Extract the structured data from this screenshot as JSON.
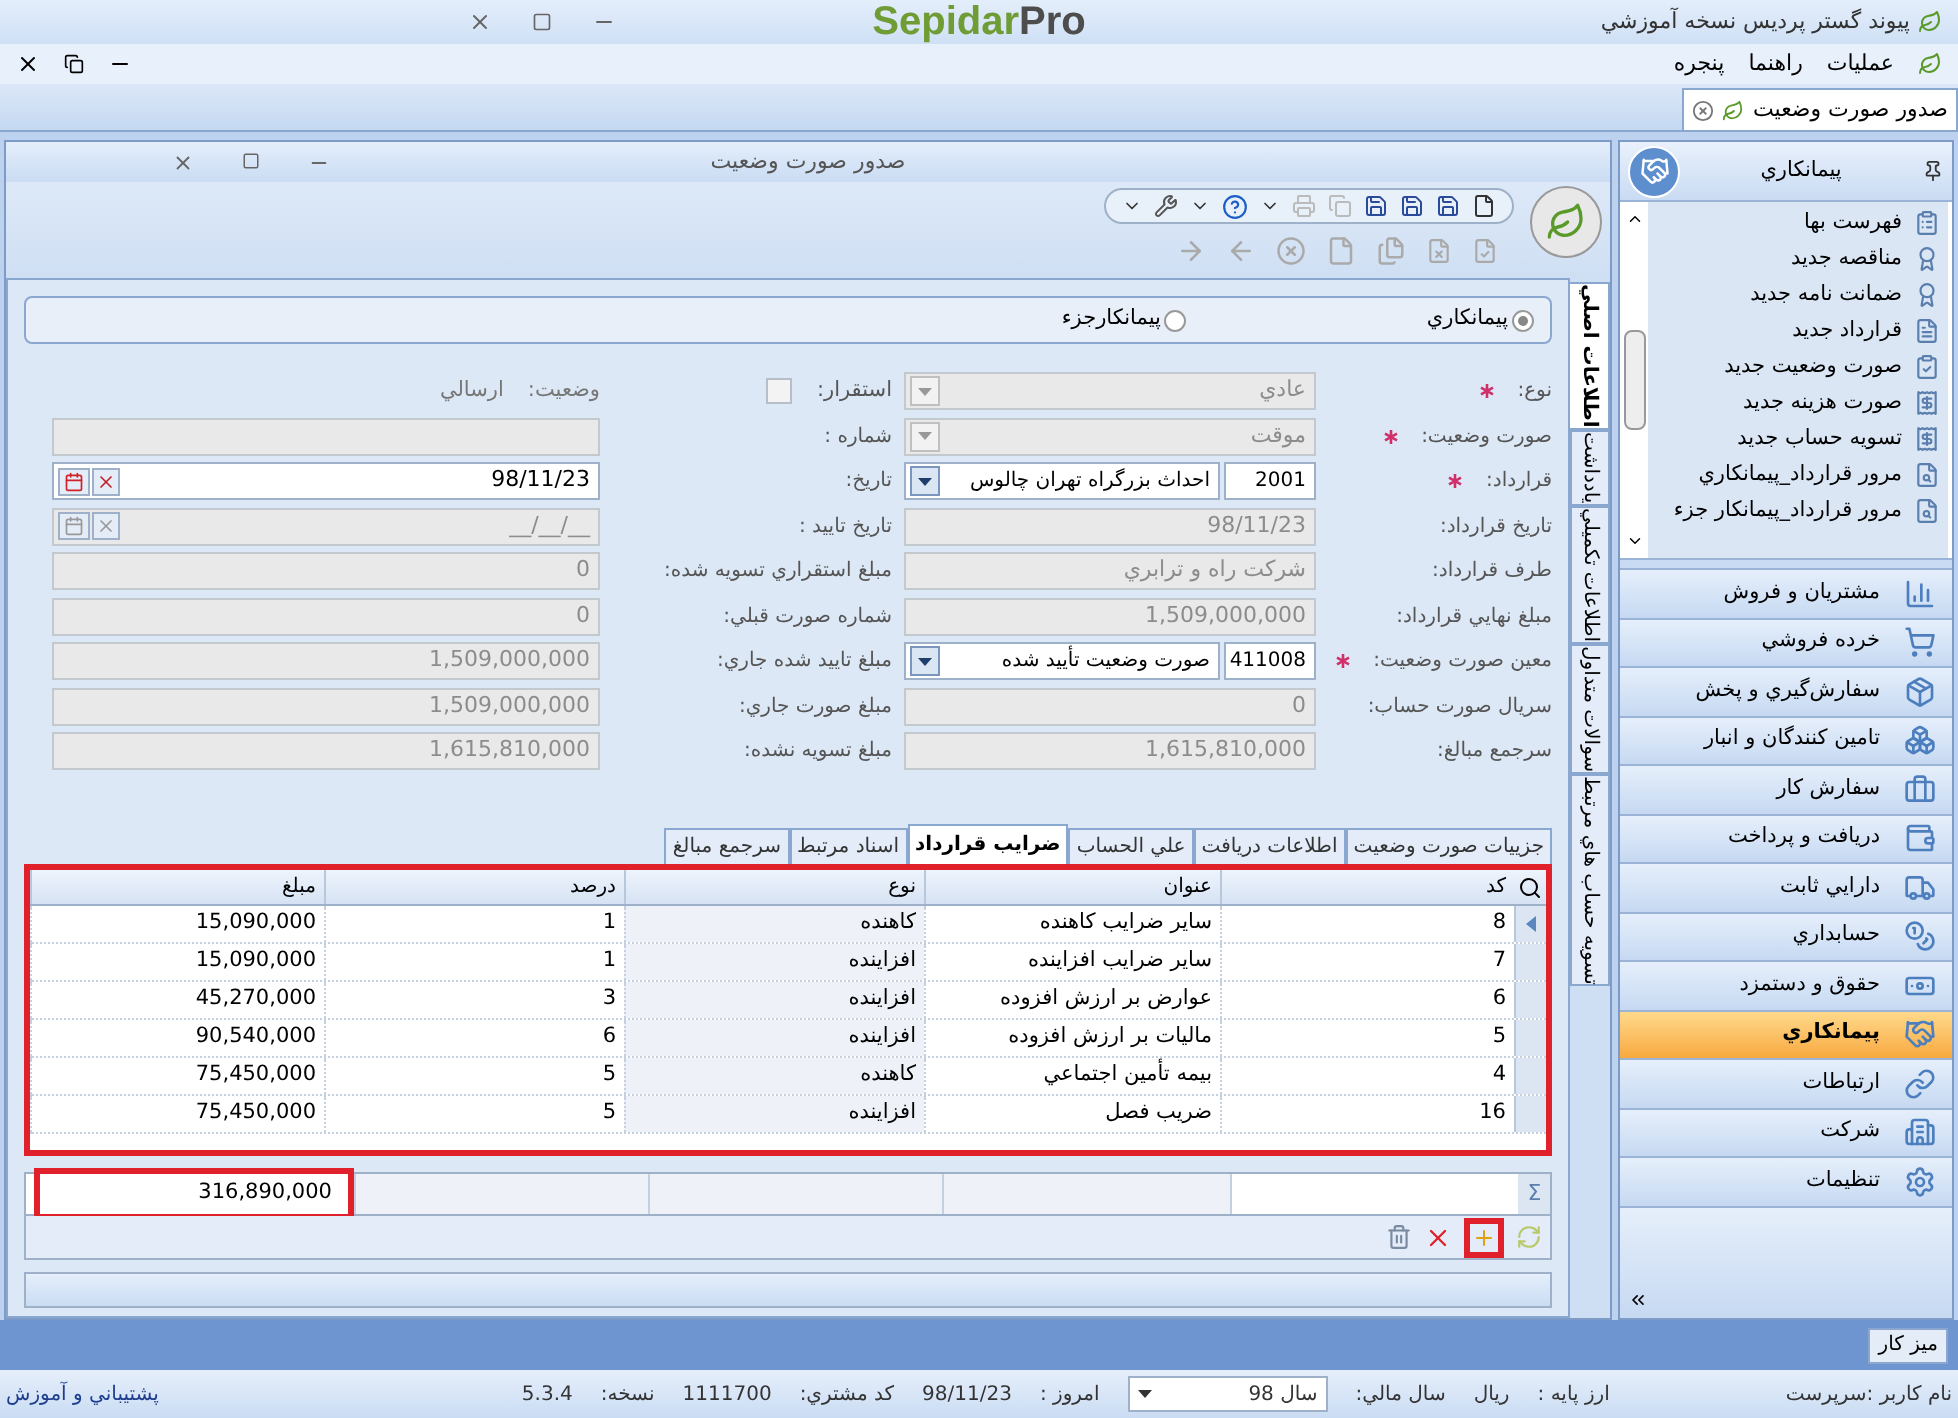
{
  "app_title": "پیوند گستر پردیس نسخه آموزشي",
  "logo": {
    "part_1": "Sepidar",
    "part_2": "Pro"
  },
  "menu": [
    "عملیات",
    "راهنما",
    "پنجره"
  ],
  "doc_tabs": [
    {
      "label": "صدور صورت وضعیت",
      "selected": true
    }
  ],
  "window": {
    "title": "صدور صورت وضعیت"
  },
  "radio_options": [
    {
      "label": "پیمانکاري",
      "selected": true
    },
    {
      "label": "پیمانکارجزء",
      "selected": false
    }
  ],
  "side_tabs": [
    {
      "label": "اطلاعات اصلي",
      "selected": true
    },
    {
      "label": "یادداشت",
      "selected": false
    },
    {
      "label": "اطلاعات تکمیلي",
      "selected": false
    },
    {
      "label": "سوالات متداول",
      "selected": false
    },
    {
      "label": "تسویه حساب هاي مرتبط",
      "selected": false
    }
  ],
  "right_fields": [
    {
      "label": "نوع:",
      "required": true,
      "kind": "dropdown",
      "value": "عادي",
      "disabled": true
    },
    {
      "label": "صورت وضعیت:",
      "required": true,
      "kind": "dropdown",
      "value": "موقت",
      "disabled": true
    },
    {
      "label": "قرارداد:",
      "required": true,
      "kind": "code_dropdown",
      "code": "2001",
      "value": "احداث بزرگراه تهران چالوس",
      "disabled": false
    },
    {
      "label": "تاریخ قرارداد:",
      "required": false,
      "kind": "text",
      "value": "98/11/23",
      "disabled": true
    },
    {
      "label": "طرف قرارداد:",
      "required": false,
      "kind": "text",
      "value": "شرکت راه و ترابري",
      "disabled": true
    },
    {
      "label": "مبلغ نهایي قرارداد:",
      "required": false,
      "kind": "text",
      "value": "1,509,000,000",
      "disabled": true
    },
    {
      "label": "معین صورت وضعیت:",
      "required": true,
      "kind": "code_dropdown",
      "code": "411008",
      "value": "صورت وضعیت تأیید شده",
      "disabled": false
    },
    {
      "label": "سریال صورت حساب:",
      "required": false,
      "kind": "text",
      "value": "0",
      "disabled": true
    },
    {
      "label": "سرجمع مبالغ:",
      "required": false,
      "kind": "text",
      "value": "1,615,810,000",
      "disabled": true
    }
  ],
  "left_fields": [
    {
      "label": "استقرار:",
      "kind": "checkbox_status",
      "checked": false,
      "status_label": "وضعیت:",
      "status": "ارسالي"
    },
    {
      "label": "شماره :",
      "kind": "text",
      "disabled": true
    },
    {
      "label": "تاریخ:",
      "kind": "date",
      "value": "98/11/23",
      "disabled": false
    },
    {
      "label": "تاریخ تایید :",
      "kind": "date",
      "value": "__/__/__",
      "disabled": true
    },
    {
      "label": "مبلغ استقراري تسويه شده:",
      "kind": "text",
      "value": "0",
      "disabled": true
    },
    {
      "label": "شماره صورت  قبلي:",
      "kind": "text",
      "value": "0",
      "disabled": true
    },
    {
      "label": "مبلغ  تایید شده جاري:",
      "kind": "text",
      "value": "1,509,000,000",
      "disabled": true
    },
    {
      "label": "مبلغ صورت جاري:",
      "kind": "text",
      "value": "1,509,000,000",
      "disabled": true
    },
    {
      "label": "مبلغ تسويه نشده:",
      "kind": "text",
      "value": "1,615,810,000",
      "disabled": true
    }
  ],
  "detail_tabs": [
    {
      "label": "جزییات صورت وضعیت",
      "selected": false
    },
    {
      "label": "اطلاعات دریافت",
      "selected": false
    },
    {
      "label": "علي الحساب",
      "selected": false
    },
    {
      "label": "ضرایب قرارداد",
      "selected": true
    },
    {
      "label": "اسناد مرتبط",
      "selected": false
    },
    {
      "label": "سرجمع مبالغ",
      "selected": false
    }
  ],
  "table": {
    "columns": [
      "کد",
      "عنوان",
      "نوع",
      "درصد",
      "مبلغ"
    ],
    "rows": [
      {
        "selected": true,
        "cells": [
          "8",
          "ساير ضرایب کاهنده",
          "کاهنده",
          "1",
          "15,090,000"
        ]
      },
      {
        "selected": false,
        "cells": [
          "7",
          "ساير ضرایب افزاینده",
          "افزاینده",
          "1",
          "15,090,000"
        ]
      },
      {
        "selected": false,
        "cells": [
          "6",
          "عوارض بر ارزش افزوده",
          "افزاینده",
          "3",
          "45,270,000"
        ]
      },
      {
        "selected": false,
        "cells": [
          "5",
          "مالیات بر ارزش افزوده",
          "افزاینده",
          "6",
          "90,540,000"
        ]
      },
      {
        "selected": false,
        "cells": [
          "4",
          "بیمه تأمین اجتماعي",
          "کاهنده",
          "5",
          "75,450,000"
        ]
      },
      {
        "selected": false,
        "cells": [
          "16",
          "ضریب فصل",
          "افزاینده",
          "5",
          "75,450,000"
        ]
      }
    ],
    "sum_symbol": "Σ",
    "total": "316,890,000"
  },
  "sidebar": {
    "title": "پیمانکاري",
    "items": [
      "فهرست بها",
      "مناقصه جدید",
      "ضمانت نامه جدید",
      "قرارداد جدید",
      "صورت وضعیت جدید",
      "صورت هزینه جدید",
      "تسویه حساب جدید",
      "مرور قرارداد_پیمانکاري",
      "مرور قرارداد_پیمانکار جزء"
    ],
    "modules": [
      {
        "label": "مشتریان و فروش",
        "selected": false
      },
      {
        "label": "خرده فروشي",
        "selected": false
      },
      {
        "label": "سفارش‌گیري و پخش",
        "selected": false
      },
      {
        "label": "تامین کنندگان و انبار",
        "selected": false
      },
      {
        "label": "سفارش کار",
        "selected": false
      },
      {
        "label": "دریافت و پرداخت",
        "selected": false
      },
      {
        "label": "دارایي ثابت",
        "selected": false
      },
      {
        "label": "حسابداري",
        "selected": false
      },
      {
        "label": "حقوق و دستمزد",
        "selected": false
      },
      {
        "label": "پیمانکاري",
        "selected": true
      },
      {
        "label": "ارتباطات",
        "selected": false
      },
      {
        "label": "شرکت",
        "selected": false
      },
      {
        "label": "تنظیمات",
        "selected": false
      }
    ]
  },
  "taskbar": [
    "میز کار"
  ],
  "status_bar": {
    "user": "نام کاربر :سرپرست",
    "currency_label": "ارز پایه :",
    "currency": "ریال",
    "year_label": "سال مالي:",
    "year": "سال 98",
    "today_label": "امروز :",
    "today": "98/11/23",
    "customer_label": "کد مشتري:",
    "customer": "1111700",
    "version_label": "نسخه:",
    "version": "5.3.4",
    "support": "پشتیباني و آموزش"
  }
}
